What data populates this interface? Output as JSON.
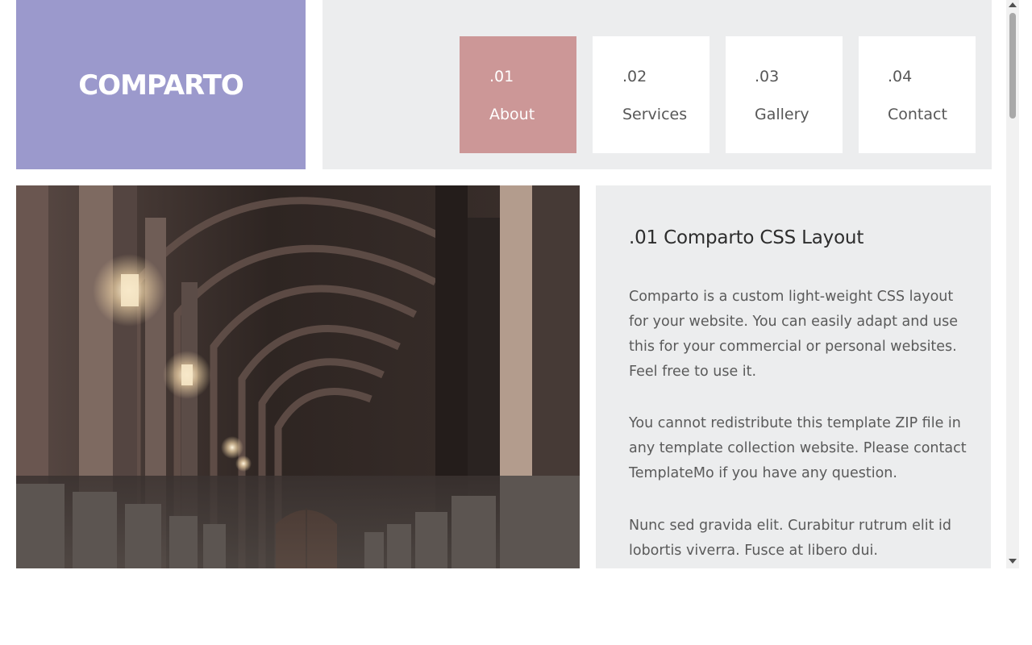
{
  "logo": {
    "text": "COMPARTO"
  },
  "nav": {
    "items": [
      {
        "num": ".01",
        "label": "About",
        "active": true
      },
      {
        "num": ".02",
        "label": "Services",
        "active": false
      },
      {
        "num": ".03",
        "label": "Gallery",
        "active": false
      },
      {
        "num": ".04",
        "label": "Contact",
        "active": false
      }
    ]
  },
  "content": {
    "title": ".01 Comparto CSS Layout",
    "paragraphs": [
      "Comparto is a custom light-weight CSS layout for your website. You can easily adapt and use this for your commercial or personal websites. Feel free to use it.",
      "You cannot redistribute this template ZIP file in any template collection website. Please contact TemplateMo if you have any question.",
      "Nunc sed gravida elit. Curabitur rutrum elit id lobortis viverra. Fusce at libero dui."
    ]
  },
  "colors": {
    "logo_bg": "#9b99cc",
    "nav_active_bg": "#cc9797",
    "panel_bg": "#ecedee"
  }
}
